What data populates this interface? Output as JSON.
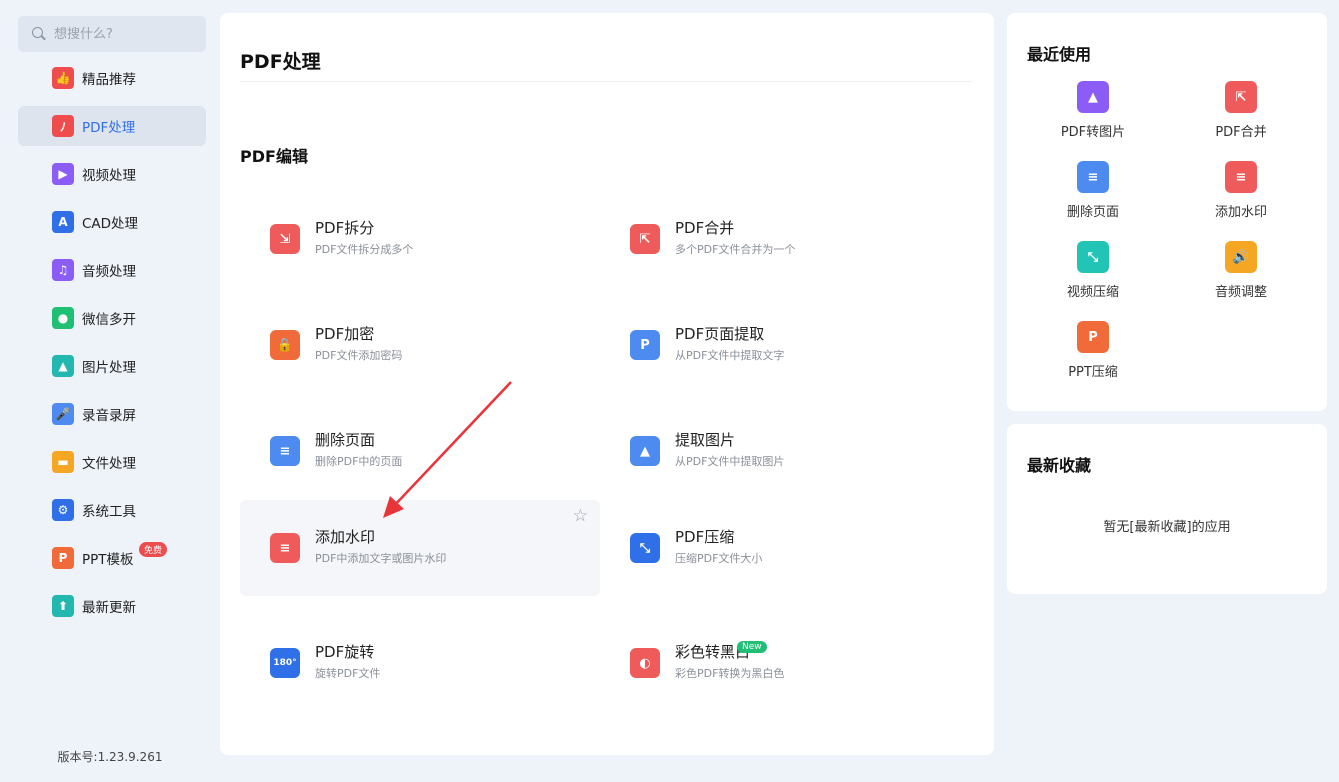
{
  "search": {
    "placeholder": "想搜什么?"
  },
  "sidebar": {
    "items": [
      {
        "label": "精品推荐",
        "icon": "thumbs-up-icon",
        "color": "#ef4d4d"
      },
      {
        "label": "PDF处理",
        "icon": "pdf-icon",
        "color": "#ef4d4d"
      },
      {
        "label": "视频处理",
        "icon": "play-icon",
        "color": "#8b5cf6"
      },
      {
        "label": "CAD处理",
        "icon": "cad-icon",
        "color": "#2f6fe8"
      },
      {
        "label": "音频处理",
        "icon": "music-icon",
        "color": "#8b5cf6"
      },
      {
        "label": "微信多开",
        "icon": "wechat-icon",
        "color": "#1fbf74"
      },
      {
        "label": "图片处理",
        "icon": "image-icon",
        "color": "#22b8b0"
      },
      {
        "label": "录音录屏",
        "icon": "microphone-icon",
        "color": "#4d8bf0"
      },
      {
        "label": "文件处理",
        "icon": "folder-icon",
        "color": "#f5a623"
      },
      {
        "label": "系统工具",
        "icon": "gear-icon",
        "color": "#2f6fe8"
      },
      {
        "label": "PPT模板",
        "icon": "ppt-icon",
        "color": "#f06a3a",
        "badge": "免费"
      },
      {
        "label": "最新更新",
        "icon": "upload-icon",
        "color": "#22b8b0"
      }
    ],
    "active_index": 1
  },
  "version": "版本号:1.23.9.261",
  "main": {
    "title": "PDF处理",
    "section": "PDF编辑",
    "tools": [
      {
        "name": "PDF拆分",
        "desc": "PDF文件拆分成多个",
        "icon": "split-icon",
        "color": "#ef5a5a"
      },
      {
        "name": "PDF合并",
        "desc": "多个PDF文件合并为一个",
        "icon": "merge-icon",
        "color": "#ef5a5a"
      },
      {
        "name": "PDF加密",
        "desc": "PDF文件添加密码",
        "icon": "lock-icon",
        "color": "#f06a3a"
      },
      {
        "name": "PDF页面提取",
        "desc": "从PDF文件中提取文字",
        "icon": "page-extract-icon",
        "color": "#4d8bf0"
      },
      {
        "name": "删除页面",
        "desc": "删除PDF中的页面",
        "icon": "delete-page-icon",
        "color": "#4d8bf0"
      },
      {
        "name": "提取图片",
        "desc": "从PDF文件中提取图片",
        "icon": "extract-image-icon",
        "color": "#4d8bf0"
      },
      {
        "name": "添加水印",
        "desc": "PDF中添加文字或图片水印",
        "icon": "watermark-icon",
        "color": "#ef5a5a"
      },
      {
        "name": "PDF压缩",
        "desc": "压缩PDF文件大小",
        "icon": "compress-icon",
        "color": "#2f6fe8"
      },
      {
        "name": "PDF旋转",
        "desc": "旋转PDF文件",
        "icon": "rotate-icon",
        "color": "#2f6fe8",
        "glyph": "180°"
      },
      {
        "name": "彩色转黑白",
        "desc": "彩色PDF转换为黑白色",
        "icon": "color-to-bw-icon",
        "color": "#ef5a5a",
        "badge": "New"
      }
    ]
  },
  "recent": {
    "title": "最近使用",
    "items": [
      {
        "label": "PDF转图片",
        "icon": "pdf-to-image-icon",
        "color": "#8b5cf6"
      },
      {
        "label": "PDF合并",
        "icon": "merge-icon",
        "color": "#ef5a5a"
      },
      {
        "label": "删除页面",
        "icon": "delete-page-icon",
        "color": "#4d8bf0"
      },
      {
        "label": "添加水印",
        "icon": "watermark-icon",
        "color": "#ef5a5a"
      },
      {
        "label": "视频压缩",
        "icon": "video-compress-icon",
        "color": "#22c5b5"
      },
      {
        "label": "音频调整",
        "icon": "speaker-icon",
        "color": "#f5a623"
      },
      {
        "label": "PPT压缩",
        "icon": "ppt-compress-icon",
        "color": "#f06a3a"
      }
    ]
  },
  "favorites": {
    "title": "最新收藏",
    "empty": "暂无[最新收藏]的应用"
  }
}
